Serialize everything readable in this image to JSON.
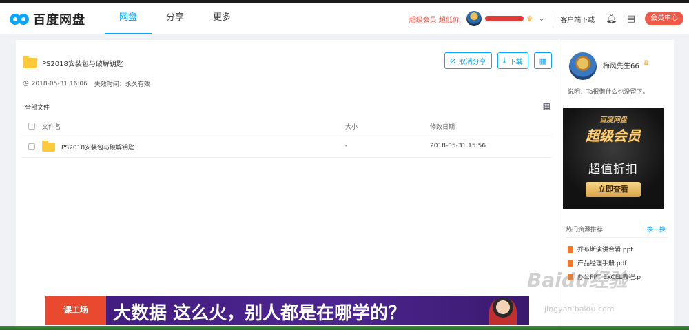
{
  "header": {
    "logo_text": "百度网盘",
    "nav": [
      "网盘",
      "分享",
      "更多"
    ],
    "vip_promo": "超级会员 超低价",
    "client_download": "客户端下载",
    "vip_center": "会员中心"
  },
  "share": {
    "title": "PS2018安装包与破解钥匙",
    "created": "2018-05-31 16:06",
    "expiry": "失效时间：永久有效",
    "buttons": {
      "cancel": "取消分享",
      "download": "下载"
    }
  },
  "breadcrumb": "全部文件",
  "table": {
    "headers": [
      "文件名",
      "大小",
      "修改日期"
    ],
    "rows": [
      {
        "name": "PS2018安装包与破解钥匙",
        "size": "-",
        "date": "2018-05-31 15:56"
      }
    ]
  },
  "sidebar": {
    "username": "梅风先生66",
    "description": "说明：Ta很懒什么也没留下。",
    "ad": {
      "logo": "百度网盘",
      "title": "超级会员",
      "subtitle": "超值折扣",
      "button": "立即查看"
    },
    "hot_title": "热门资源推荐",
    "hot_refresh": "换一换",
    "hot_items": [
      "乔布斯演讲合辑.ppt",
      "产品经理手册.pdf",
      "办公PPT EXCEL教程.p"
    ]
  },
  "banner": {
    "logo": "课工场",
    "text_bold": "大数据",
    "text_rest": " 这么火，别人都是在哪学的？"
  },
  "watermark": {
    "main": "Baidu经验",
    "sub": "jingyan.baidu.com"
  },
  "colors": {
    "accent": "#06a7ff",
    "vip": "#f05a4a",
    "folder": "#ffc93c"
  }
}
